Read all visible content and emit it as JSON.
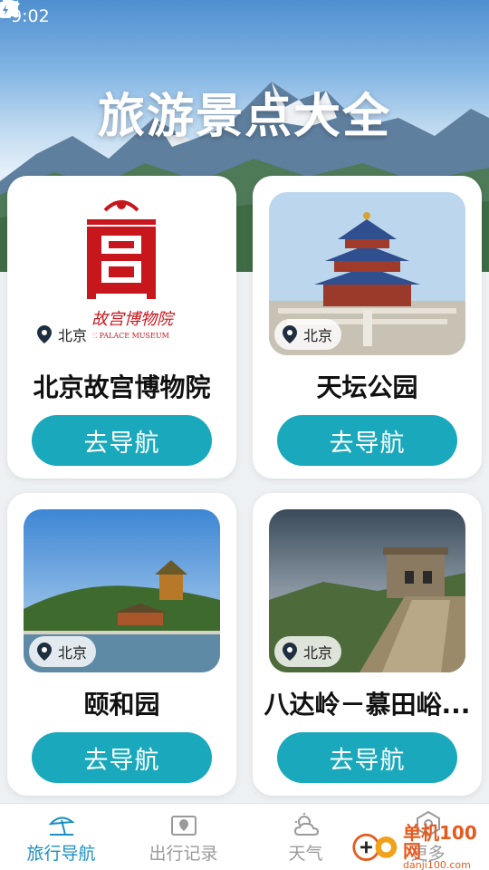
{
  "status_bar": {
    "time": "9:02"
  },
  "header": {
    "title": "旅游景点大全"
  },
  "colors": {
    "accent": "#1aa9bc",
    "active_tab": "#1a8fc4",
    "inactive_tab": "#9a9a9a"
  },
  "cards": [
    {
      "location": "北京",
      "name": "北京故宫博物院",
      "button_label": "去导航",
      "logo_text": "故宫博物院",
      "logo_subtext": "E PALACE MUSEUM"
    },
    {
      "location": "北京",
      "name": "天坛公园",
      "button_label": "去导航"
    },
    {
      "location": "北京",
      "name": "颐和园",
      "button_label": "去导航"
    },
    {
      "location": "北京",
      "name": "八达岭－慕田峪...",
      "button_label": "去导航"
    }
  ],
  "tabs": [
    {
      "label": "旅行导航",
      "icon": "beach-umbrella-icon",
      "active": true
    },
    {
      "label": "出行记录",
      "icon": "map-pin-icon",
      "active": false
    },
    {
      "label": "天气",
      "icon": "weather-icon",
      "active": false
    },
    {
      "label": "更多",
      "icon": "settings-icon",
      "active": false
    }
  ],
  "watermark": {
    "main": "单机100网",
    "sub": "danji100.com"
  }
}
